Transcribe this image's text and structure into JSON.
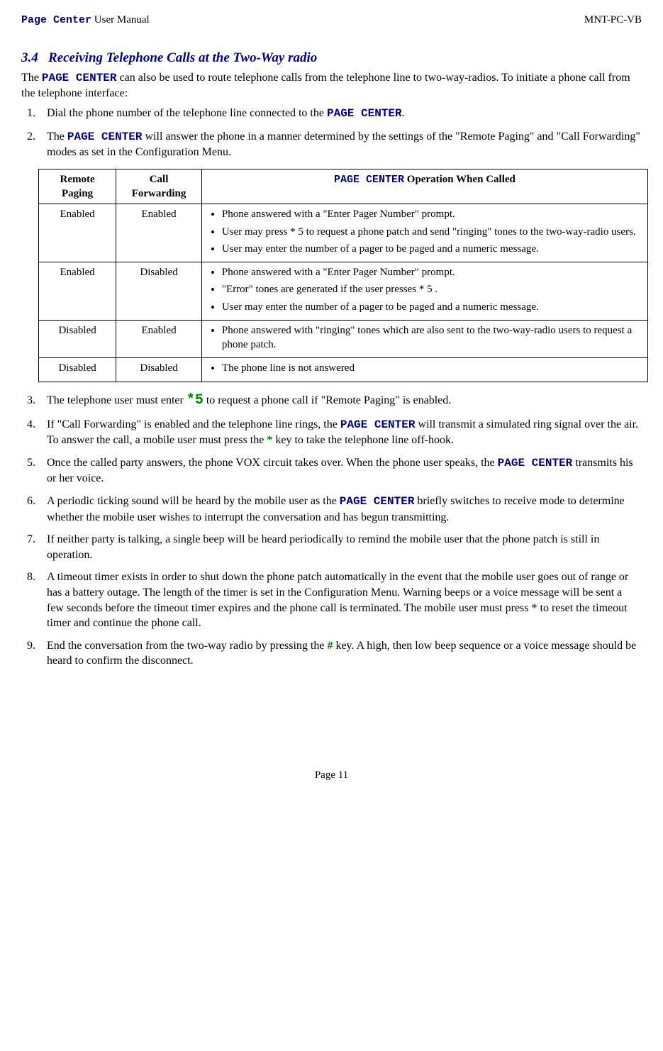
{
  "header": {
    "left_prefix": "Page Center",
    "left_suffix": " User Manual",
    "right": "MNT-PC-VB"
  },
  "section": {
    "num": "3.4",
    "title": "Receiving Telephone Calls at the Two-Way radio"
  },
  "intro": {
    "a": "The ",
    "b": "PAGE CENTER",
    "c": " can also be used to route telephone calls from the telephone line to two-way-radios.  To initiate a phone call from the telephone interface:"
  },
  "s1": {
    "a": "Dial the phone number of the telephone line connected to the ",
    "b": "PAGE CENTER",
    "c": "."
  },
  "s2": {
    "a": "The ",
    "b": "PAGE CENTER",
    "c": " will answer the phone in a manner determined by the settings of the \"Remote Paging\" and \"Call Forwarding\" modes as set in the Configuration Menu."
  },
  "tbl": {
    "h1": "Remote Paging",
    "h2": "Call Forwarding",
    "h3a": "PAGE CENTER",
    "h3b": "  Operation When Called",
    "r1c1": "Enabled",
    "r1c2": "Enabled",
    "r1b1": "Phone answered with a \"Enter Pager Number\" prompt.",
    "r1b2": "User may press * 5 to request a phone patch and send \"ringing\" tones to the two-way-radio users.",
    "r1b3": "User may enter the number of a pager to be paged and a numeric message.",
    "r2c1": "Enabled",
    "r2c2": "Disabled",
    "r2b1": "Phone answered with a \"Enter Pager Number\" prompt.",
    "r2b2": "\"Error\" tones are generated if the user presses * 5 .",
    "r2b3": "User may enter the number of a pager to be paged and a numeric message.",
    "r3c1": "Disabled",
    "r3c2": "Enabled",
    "r3b1": "Phone answered with \"ringing\" tones which are also sent to the two-way-radio users to request a phone patch.",
    "r4c1": "Disabled",
    "r4c2": "Disabled",
    "r4b1": "The phone line is not answered"
  },
  "s3": {
    "a": "The telephone user must enter  ",
    "key": "*5",
    "b": "  to request a phone call if  \"Remote Paging\" is enabled."
  },
  "s4": {
    "a": "If \"Call Forwarding\" is enabled and the telephone line rings, the ",
    "b": "PAGE CENTER",
    "c": " will transmit a simulated ring signal over the air.  To answer the call, a mobile user must press the ",
    "key": "*",
    "d": " key to take the telephone line off-hook."
  },
  "s5": {
    "a": "Once the called party answers, the phone VOX circuit takes over.  When the phone user speaks, the ",
    "b": "PAGE CENTER",
    "c": " transmits his or her voice."
  },
  "s6": {
    "a": "A periodic ticking sound will be heard by the mobile user as the  ",
    "b": "PAGE CENTER",
    "c": "  briefly switches to receive mode to determine whether the mobile user wishes to interrupt the conversation and has begun transmitting."
  },
  "s7": "If neither party is talking, a single beep will be heard periodically to remind the mobile user that the phone patch is still in operation.",
  "s8": {
    "a": "A timeout timer exists in order to shut down the phone patch automatically in the event that the mobile user goes out of range or has a battery outage.  The length of the timer is set in the Configuration Menu.  Warning beeps or a voice message will be sent a few seconds before the timeout timer expires and the phone call is terminated.  The mobile user must press ",
    "key": "*",
    "b": " to reset the timeout timer and continue the phone call."
  },
  "s9": {
    "a": "End the conversation from the two-way radio by pressing the ",
    "key": "#",
    "b": " key.  A high, then low beep sequence or a voice message should be heard to confirm the disconnect."
  },
  "footer": "Page 11"
}
